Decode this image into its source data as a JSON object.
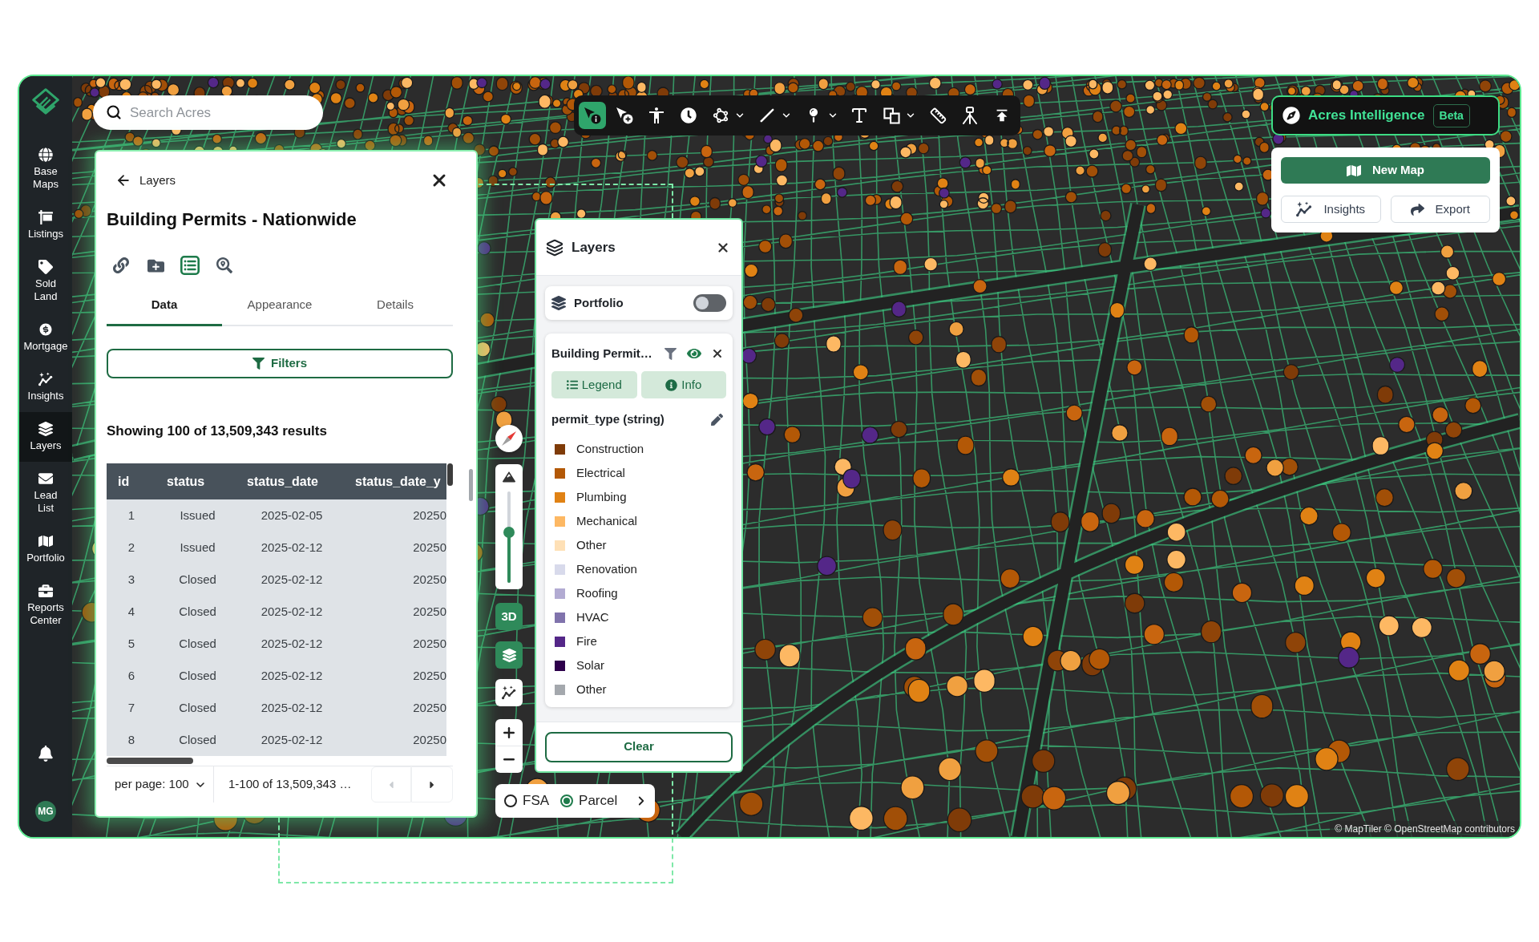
{
  "sidebar": {
    "items": [
      {
        "label": "Base Maps",
        "selected": false
      },
      {
        "label": "Listings",
        "selected": false
      },
      {
        "label": "Sold Land",
        "selected": false
      },
      {
        "label": "Mortgage",
        "selected": false
      },
      {
        "label": "Insights",
        "selected": false
      },
      {
        "label": "Layers",
        "selected": true
      },
      {
        "label": "Lead List",
        "selected": false
      },
      {
        "label": "Portfolio",
        "selected": false
      },
      {
        "label": "Reports Center",
        "selected": false
      }
    ],
    "avatar": "MG"
  },
  "search": {
    "placeholder": "Search Acres"
  },
  "toolbar": {
    "tools": [
      {
        "selected": true,
        "has_menu": false
      },
      {
        "selected": false,
        "has_menu": false
      },
      {
        "selected": false,
        "has_menu": false
      },
      {
        "selected": false,
        "has_menu": false
      },
      {
        "selected": false,
        "has_menu": true
      },
      {
        "selected": false,
        "has_menu": true
      },
      {
        "selected": false,
        "has_menu": true
      },
      {
        "selected": false,
        "has_menu": false
      },
      {
        "selected": false,
        "has_menu": true
      },
      {
        "selected": false,
        "has_menu": false
      },
      {
        "selected": false,
        "has_menu": false
      },
      {
        "selected": false,
        "has_menu": false
      }
    ]
  },
  "data_panel": {
    "back_label": "Layers",
    "title": "Building Permits - Nationwide",
    "actions": [
      {
        "selected": false
      },
      {
        "selected": false
      },
      {
        "selected": true
      },
      {
        "selected": false
      }
    ],
    "tabs": [
      {
        "label": "Data",
        "selected": true
      },
      {
        "label": "Appearance",
        "selected": false
      },
      {
        "label": "Details",
        "selected": false
      }
    ],
    "filters_button": "Filters",
    "results_summary": "Showing 100 of 13,509,343 results",
    "table": {
      "columns": [
        "id",
        "status",
        "status_date",
        "status_date_y"
      ],
      "rows": [
        [
          "1",
          "Issued",
          "2025-02-05",
          "20250"
        ],
        [
          "2",
          "Issued",
          "2025-02-12",
          "20250"
        ],
        [
          "3",
          "Closed",
          "2025-02-12",
          "20250"
        ],
        [
          "4",
          "Closed",
          "2025-02-12",
          "20250"
        ],
        [
          "5",
          "Closed",
          "2025-02-12",
          "20250"
        ],
        [
          "6",
          "Closed",
          "2025-02-12",
          "20250"
        ],
        [
          "7",
          "Closed",
          "2025-02-12",
          "20250"
        ],
        [
          "8",
          "Closed",
          "2025-02-12",
          "20250"
        ]
      ]
    },
    "pagination": {
      "per_page": "per page: 100",
      "range": "1-100 of 13,509,343 …",
      "previous": {
        "disabled": true
      },
      "next": {
        "disabled": false
      }
    }
  },
  "layers_panel": {
    "title": "Layers",
    "portfolio": {
      "name": "Portfolio",
      "on": false
    },
    "layer": {
      "name": "Building Permit…",
      "visible": true,
      "legend_button": "Legend",
      "info_button": "Info",
      "field": "permit_type (string)",
      "legend": [
        {
          "label": "Construction",
          "color": "#7f3b08"
        },
        {
          "label": "Electrical",
          "color": "#b35806"
        },
        {
          "label": "Plumbing",
          "color": "#e08214"
        },
        {
          "label": "Mechanical",
          "color": "#fdb863"
        },
        {
          "label": "Other",
          "color": "#fee0b6"
        },
        {
          "label": "Renovation",
          "color": "#d8daeb"
        },
        {
          "label": "Roofing",
          "color": "#b2abd2"
        },
        {
          "label": "HVAC",
          "color": "#8073ac"
        },
        {
          "label": "Fire",
          "color": "#542788"
        },
        {
          "label": "Solar",
          "color": "#2d004b"
        },
        {
          "label": "Other",
          "color": "#a4a8ad"
        }
      ]
    },
    "clear_button": "Clear"
  },
  "map_controls": {
    "pitch_slider": {
      "level": 0.55
    },
    "view_buttons": [
      {
        "kind": "text",
        "label": "3D",
        "selected": true
      },
      {
        "kind": "icon",
        "selected": true
      },
      {
        "kind": "icon",
        "selected": false
      }
    ]
  },
  "boundary_toggle": {
    "options": [
      {
        "label": "FSA",
        "selected": false
      },
      {
        "label": "Parcel",
        "selected": true
      }
    ]
  },
  "assistant_button": {
    "label": "Acres Intelligence",
    "badge": "Beta"
  },
  "map_menu": {
    "new_map": "New Map",
    "insights": "Insights",
    "export": "Export"
  },
  "attribution": "© MapTiler © OpenStreetMap contributors"
}
